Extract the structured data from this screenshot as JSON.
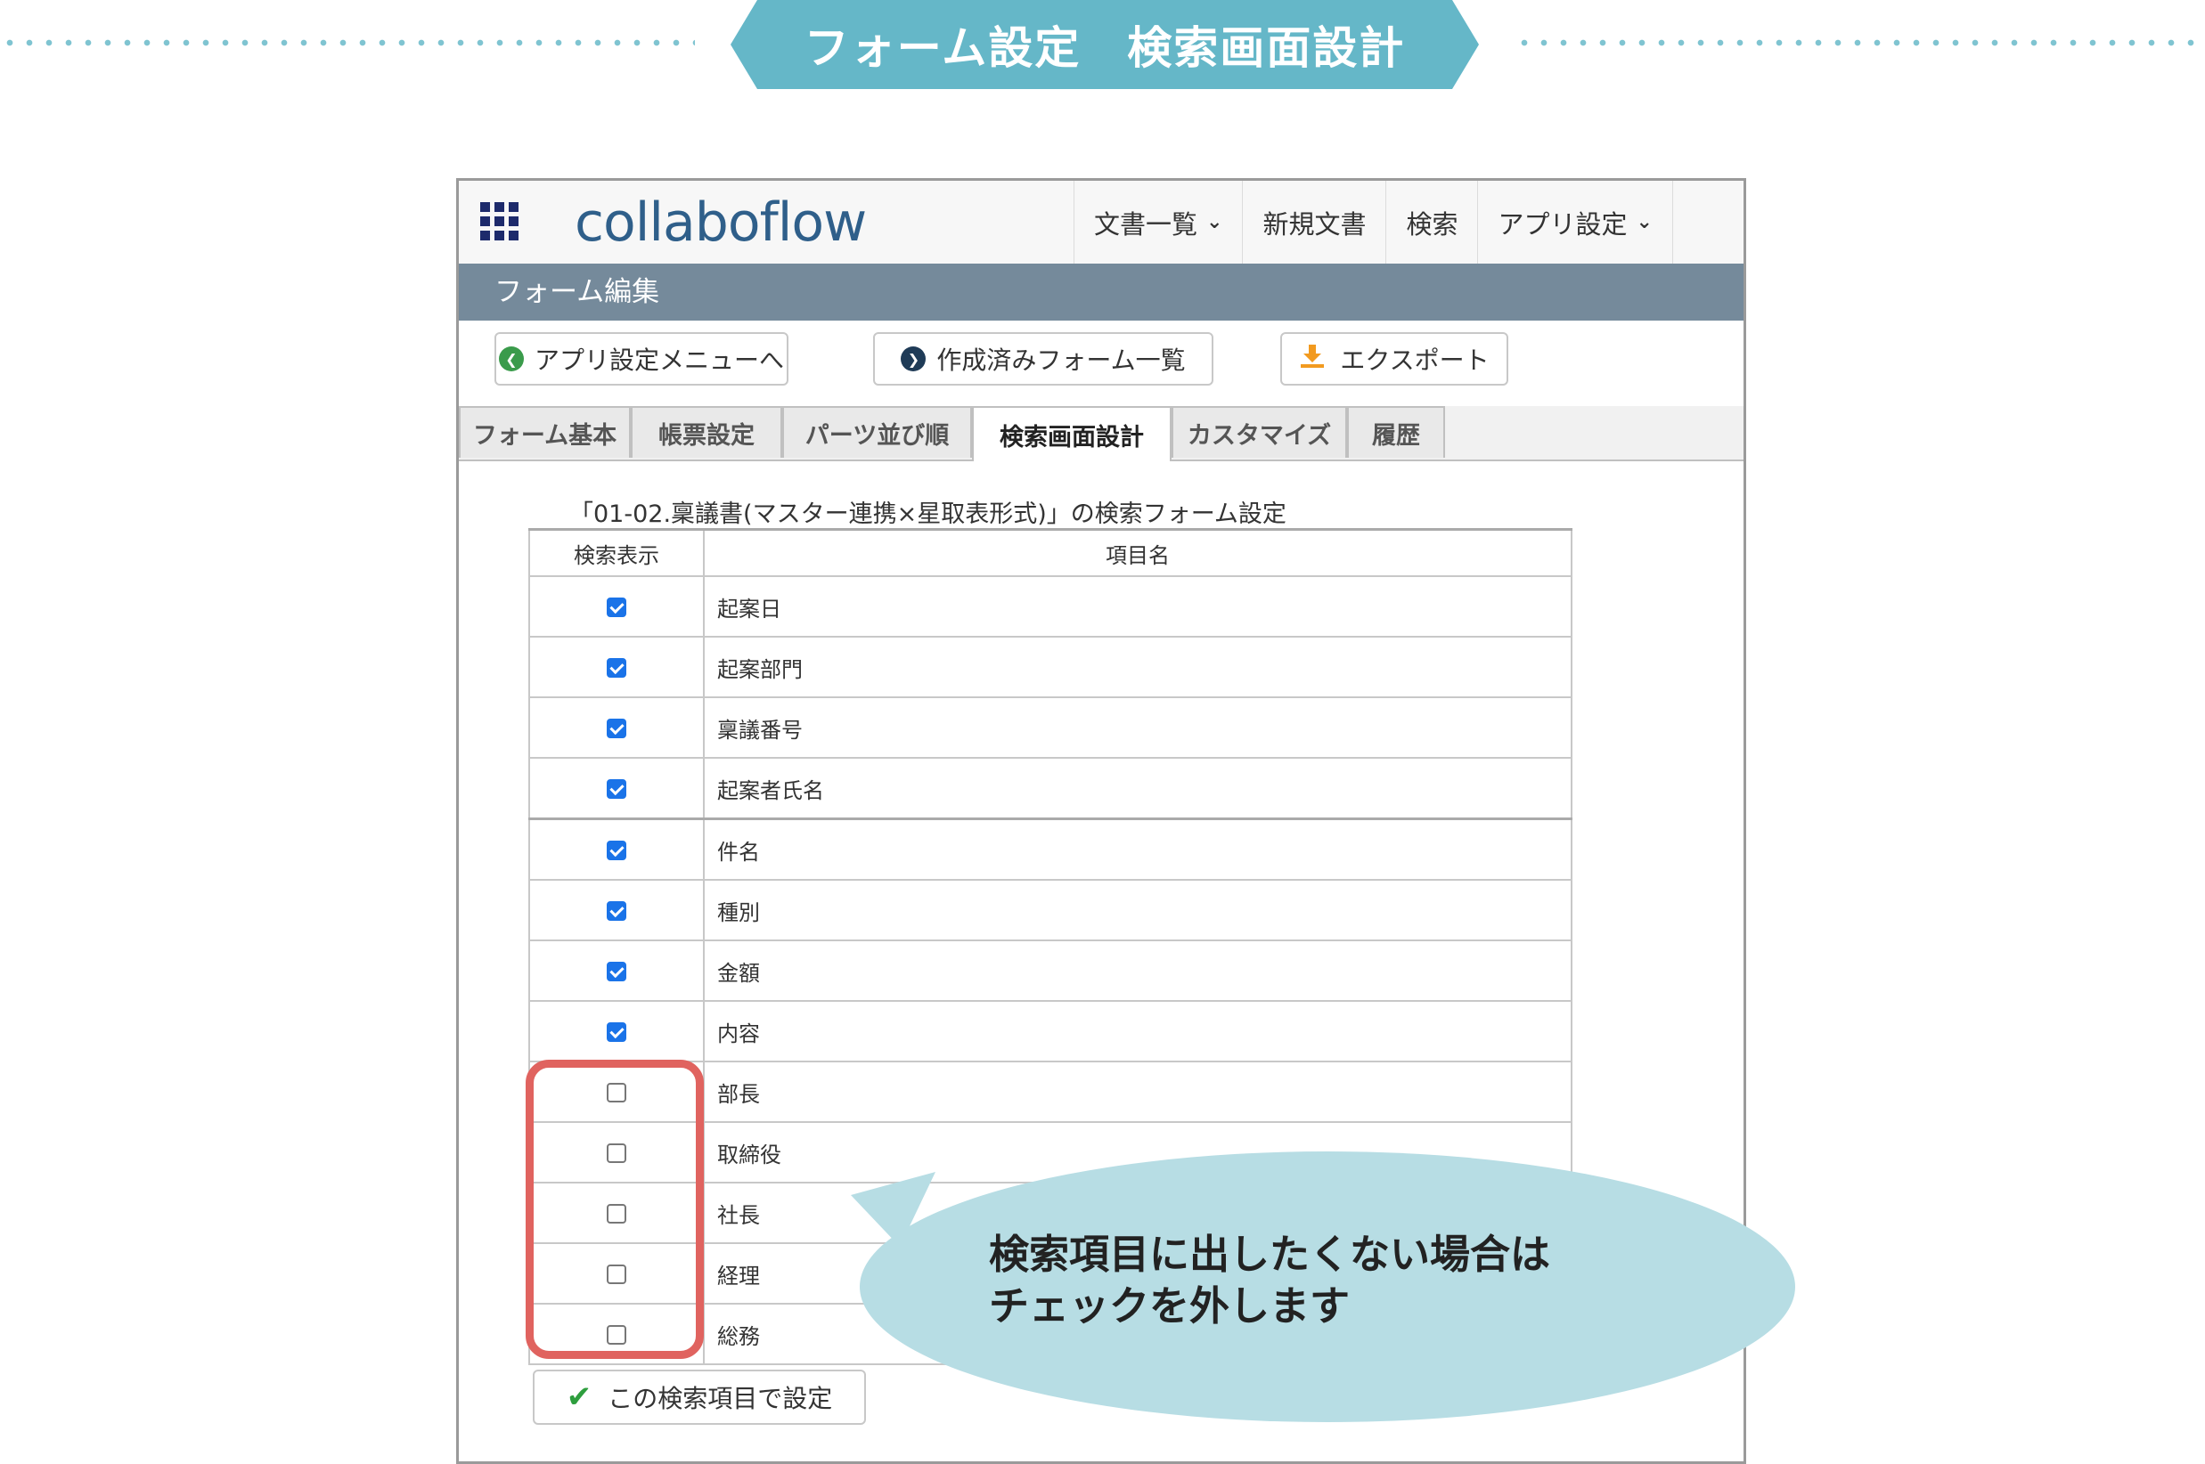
{
  "banner": {
    "title": "フォーム設定　検索画面設計",
    "color": "#65b7c8"
  },
  "app": {
    "logo": "collaboflow",
    "nav": [
      {
        "label": "文書一覧",
        "has_dropdown": true
      },
      {
        "label": "新規文書",
        "has_dropdown": false
      },
      {
        "label": "検索",
        "has_dropdown": false
      },
      {
        "label": "アプリ設定",
        "has_dropdown": true
      }
    ],
    "subheader": "フォーム編集",
    "buttons": {
      "app_menu": "アプリ設定メニューへ",
      "forms_list": "作成済みフォーム一覧",
      "export": "エクスポート"
    },
    "tabs": [
      "フォーム基本",
      "帳票設定",
      "パーツ並び順",
      "検索画面設計",
      "カスタマイズ",
      "履歴"
    ],
    "active_tab": "検索画面設計",
    "form_title": "「01-02.稟議書(マスター連携×星取表形式)」の検索フォーム設定",
    "table": {
      "col_show": "検索表示",
      "col_name": "項目名",
      "rows": [
        {
          "name": "起案日",
          "checked": true
        },
        {
          "name": "起案部門",
          "checked": true
        },
        {
          "name": "稟議番号",
          "checked": true
        },
        {
          "name": "起案者氏名",
          "checked": true
        },
        {
          "name": "件名",
          "checked": true
        },
        {
          "name": "種別",
          "checked": true
        },
        {
          "name": "金額",
          "checked": true
        },
        {
          "name": "内容",
          "checked": true
        },
        {
          "name": "部長",
          "checked": false
        },
        {
          "name": "取締役",
          "checked": false
        },
        {
          "name": "社長",
          "checked": false
        },
        {
          "name": "経理",
          "checked": false
        },
        {
          "name": "総務",
          "checked": false
        }
      ]
    },
    "save_button": "この検索項目で設定"
  },
  "callout": {
    "line1": "検索項目に出したくない場合は",
    "line2": "チェックを外します",
    "color": "#b7dde4"
  }
}
